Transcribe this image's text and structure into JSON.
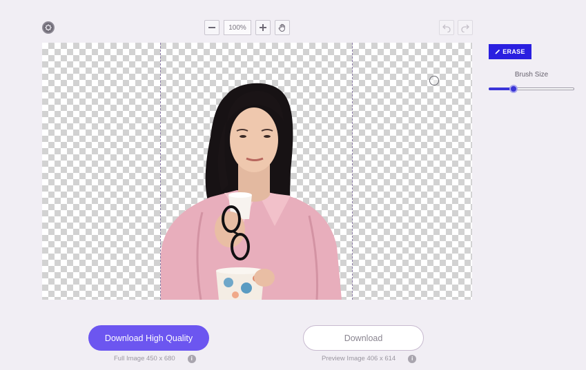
{
  "toolbar": {
    "zoom_value": "100%",
    "icons": {
      "settings": "settings-icon",
      "zoom_out": "minus-icon",
      "zoom_in": "plus-icon",
      "pan": "hand-icon",
      "undo": "undo-icon",
      "redo": "redo-icon"
    }
  },
  "tools": {
    "erase_label": "ERASE",
    "brush_size_label": "Brush Size",
    "brush_size_fraction": 0.29
  },
  "downloads": {
    "high_quality_label": "Download High Quality",
    "high_quality_info": "Full Image 450 x 680",
    "preview_label": "Download",
    "preview_info": "Preview Image 406 x 614"
  },
  "colors": {
    "primary": "#6c56f0",
    "erase": "#2a1fe0",
    "background": "#f1eef4"
  }
}
